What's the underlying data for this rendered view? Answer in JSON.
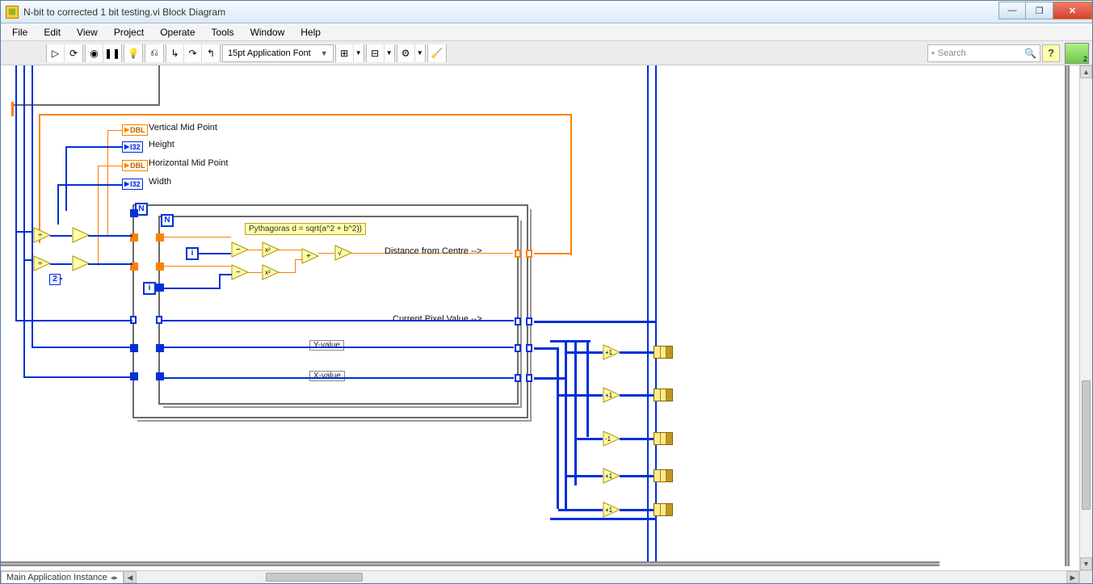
{
  "window": {
    "title": "N-bit to corrected 1 bit testing.vi Block Diagram"
  },
  "menu": {
    "file": "File",
    "edit": "Edit",
    "view": "View",
    "project": "Project",
    "operate": "Operate",
    "tools": "Tools",
    "window": "Window",
    "help": "Help"
  },
  "toolbar": {
    "font": "15pt Application Font"
  },
  "search": {
    "placeholder": "Search"
  },
  "status": {
    "instance": "Main Application Instance"
  },
  "terminals": {
    "vmid_type": "DBL",
    "vmid_label": "Vertical Mid Point",
    "height_type": "I32",
    "height_label": "Height",
    "hmid_type": "DBL",
    "hmid_label": "Horizontal Mid Point",
    "width_type": "I32",
    "width_label": "Width"
  },
  "diagram": {
    "comment": "Pythagoras d = sqrt(a^2 + b^2))",
    "dist_label": "Distance from Centre -->",
    "pix_label": "Current Pixel Value -->",
    "yval": "Y-value",
    "xval": "X-value",
    "const2": "2",
    "n1": "N",
    "n2": "N",
    "i1": "i",
    "i2": "i",
    "minus": "-1"
  }
}
